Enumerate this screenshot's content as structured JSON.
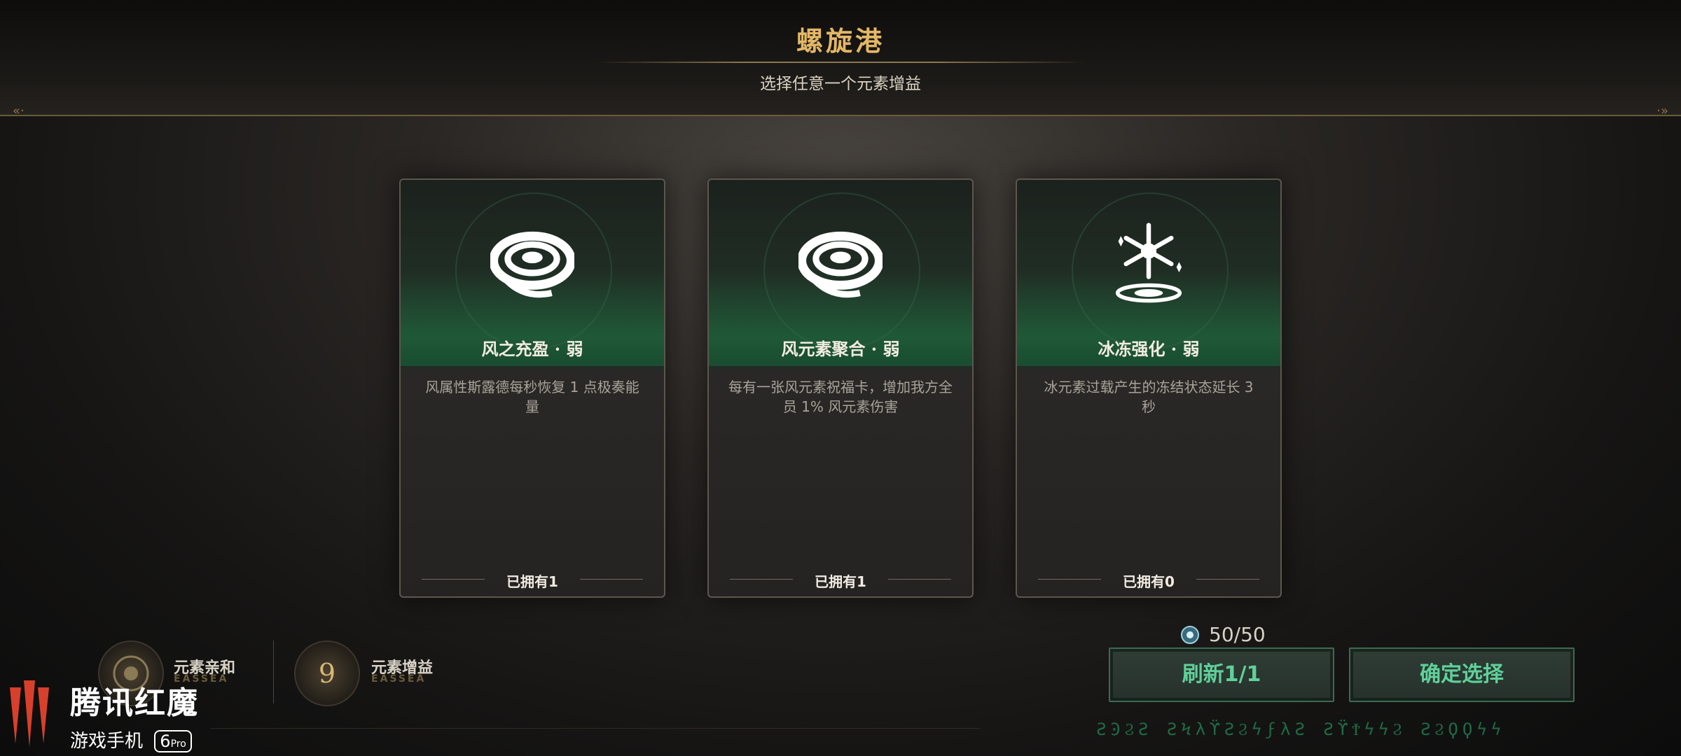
{
  "header": {
    "title": "螺旋港",
    "subtitle": "选择任意一个元素增益"
  },
  "cards": [
    {
      "name": "风之充盈 · 弱",
      "description": "风属性斯露德每秒恢复 1 点极奏能量",
      "owned": "已拥有1",
      "icon": "wind-swirl-icon"
    },
    {
      "name": "风元素聚合 · 弱",
      "description": "每有一张风元素祝福卡，增加我方全员 1% 风元素伤害",
      "owned": "已拥有1",
      "icon": "wind-swirl-icon"
    },
    {
      "name": "冰冻强化 · 弱",
      "description": "冰元素过载产生的冻结状态延长 3 秒",
      "owned": "已拥有0",
      "icon": "snowflake-icon"
    }
  ],
  "bottom": {
    "affinity_label": "元素亲和",
    "affinity_sub": "EASSEA",
    "buff_label": "元素增益",
    "buff_sub": "EASSEA",
    "buff_count": "9"
  },
  "currency": {
    "value": "50/50",
    "icon": "gem-icon"
  },
  "buttons": {
    "refresh": "刷新1/1",
    "confirm": "确定选择"
  },
  "brand": {
    "title": "腾讯红魔",
    "subtitle": "游戏手机",
    "model": "6",
    "model_suffix": "Pro"
  },
  "runes": "ƧϿϨƧ ƧϞλϔƧϨϟϝλƧ ƧϔϮϟϟϨ ƧϨϘϘϟϟ",
  "colors": {
    "accent_gold": "#e3b767",
    "button_green": "#5fd09a",
    "card_green": "#1e6440"
  }
}
